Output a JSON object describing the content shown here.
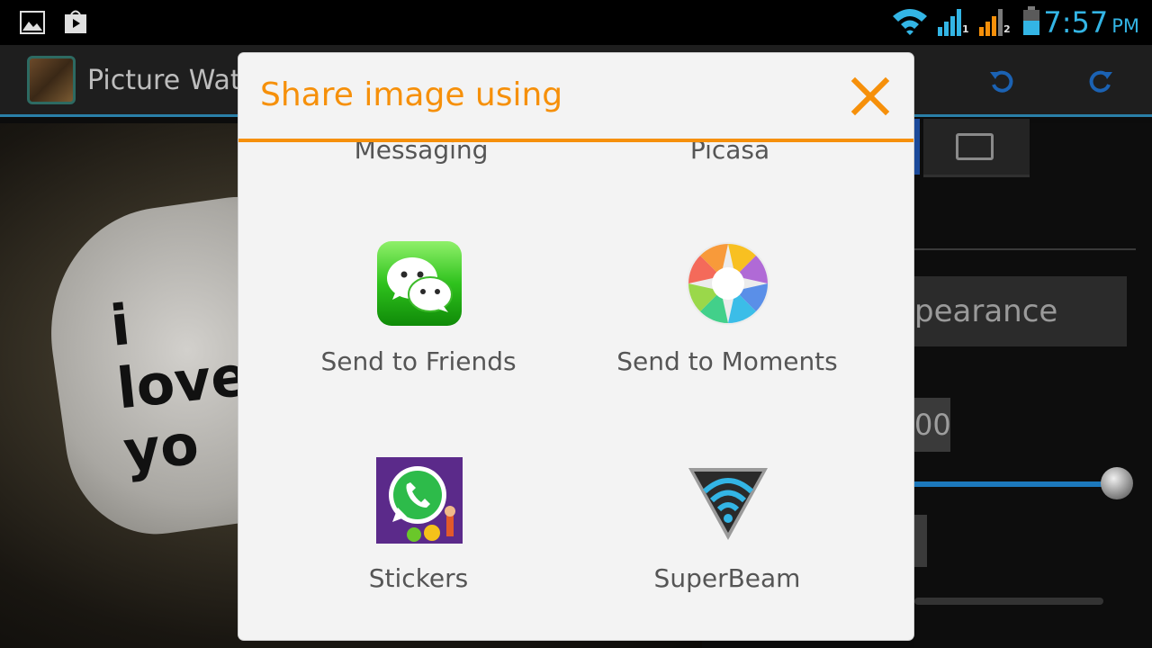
{
  "status_bar": {
    "time": "7:57",
    "ampm": "PM",
    "sim1": "1",
    "sim2": "2",
    "icons": [
      "gallery-icon",
      "play-store-icon",
      "wifi-icon",
      "signal-1-icon",
      "signal-2-icon",
      "battery-icon"
    ]
  },
  "app_bar": {
    "title": "Picture Wate",
    "undo_icon": "undo-icon",
    "redo_icon": "redo-icon"
  },
  "background": {
    "photo_text": "i\nlove\nyo",
    "appearance_label": "pearance",
    "number_value": "00"
  },
  "dialog": {
    "title": "Share image using",
    "close_icon": "close-icon",
    "partial_items": [
      "Messaging",
      "Picasa"
    ],
    "items": [
      {
        "label": "Send to Friends",
        "icon": "wechat-icon"
      },
      {
        "label": "Send to Moments",
        "icon": "moments-icon"
      },
      {
        "label": "Stickers",
        "icon": "whatsapp-stickers-icon"
      },
      {
        "label": "SuperBeam",
        "icon": "superbeam-icon"
      }
    ]
  },
  "colors": {
    "accent": "#f6900a",
    "status_blue": "#33b5e5",
    "dialog_bg": "#f3f3f3",
    "label_text": "#555555"
  }
}
